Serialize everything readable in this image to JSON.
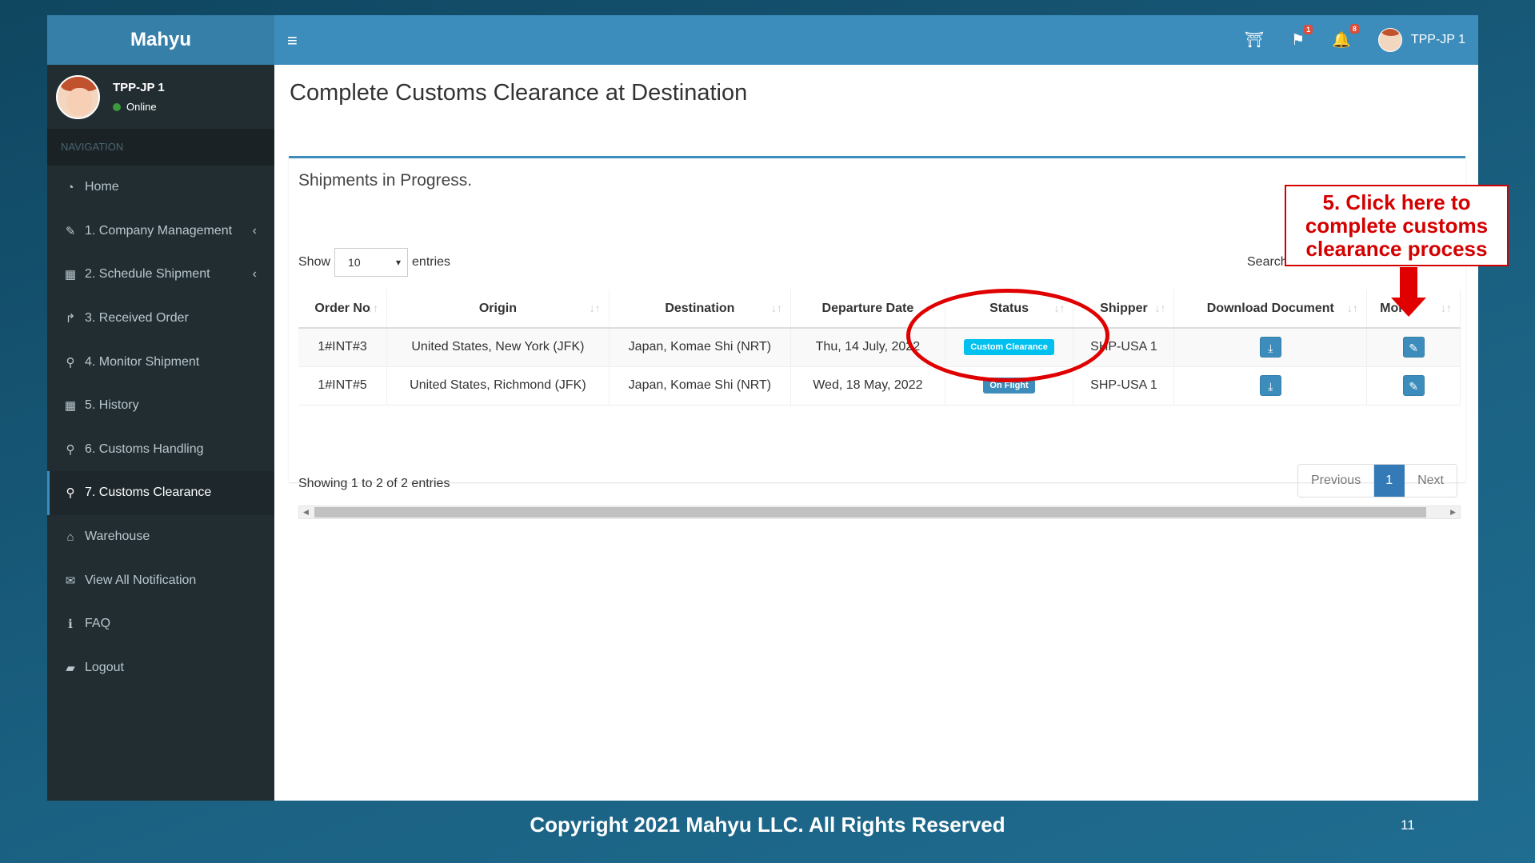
{
  "app": {
    "logo": "Mahyu"
  },
  "user": {
    "name": "TPP-JP 1",
    "status": "Online"
  },
  "nav": {
    "header": "NAVIGATION",
    "items": [
      {
        "label": "Home",
        "icon": "dashboard-icon",
        "glyph": "◔"
      },
      {
        "label": "1. Company Management",
        "icon": "edit-icon",
        "glyph": "✎",
        "arrow": "‹"
      },
      {
        "label": "2. Schedule Shipment",
        "icon": "calendar-icon",
        "glyph": "▦",
        "arrow": "‹"
      },
      {
        "label": "3. Received Order",
        "icon": "share-icon",
        "glyph": "↱"
      },
      {
        "label": "4. Monitor Shipment",
        "icon": "search-icon",
        "glyph": "⚲"
      },
      {
        "label": "5. History",
        "icon": "calendar-icon",
        "glyph": "▦"
      },
      {
        "label": "6. Customs Handling",
        "icon": "search-icon",
        "glyph": "⚲"
      },
      {
        "label": "7. Customs Clearance",
        "icon": "search-icon",
        "glyph": "⚲"
      },
      {
        "label": "Warehouse",
        "icon": "warehouse-icon",
        "glyph": "⌂"
      },
      {
        "label": "View All Notification",
        "icon": "envelope-icon",
        "glyph": "✉"
      },
      {
        "label": "FAQ",
        "icon": "info-icon",
        "glyph": "ℹ"
      },
      {
        "label": "Logout",
        "icon": "book-icon",
        "glyph": "▰"
      }
    ]
  },
  "topbar": {
    "hamburger": "≡",
    "language": "⛩",
    "flag": "⚑",
    "flag_badge": "1",
    "bell": "🔔",
    "bell_badge": "8",
    "user": "TPP-JP 1"
  },
  "page": {
    "title": "Complete Customs Clearance at Destination"
  },
  "box": {
    "title": "Shipments in Progress.",
    "show_label": "Show",
    "show_value": "10",
    "entries_label": "entries",
    "search_label": "Search:"
  },
  "table": {
    "headers": [
      "Order No",
      "Origin",
      "Destination",
      "Departure Date",
      "Status",
      "Shipper",
      "Download Document",
      "More"
    ],
    "rows": [
      {
        "order": "1#INT#3",
        "origin": "United States, New York (JFK)",
        "destination": "Japan, Komae Shi (NRT)",
        "date": "Thu, 14 July, 2022",
        "status": "Custom Clearance",
        "shipper": "SHP-USA 1"
      },
      {
        "order": "1#INT#5",
        "origin": "United States, Richmond (JFK)",
        "destination": "Japan, Komae Shi (NRT)",
        "date": "Wed, 18 May, 2022",
        "status": "On Flight",
        "shipper": "SHP-USA 1"
      }
    ]
  },
  "info": "Showing 1 to 2 of 2 entries",
  "pagination": {
    "previous": "Previous",
    "current": "1",
    "next": "Next"
  },
  "callout": {
    "line1": "5. Click here to",
    "line2": "complete customs",
    "line3": "clearance process"
  },
  "footer": {
    "copyright": "Copyright 2021 Mahyu LLC. All Rights Reserved",
    "page_number": "11"
  },
  "colors": {
    "header_blue": "#3c8dbc",
    "sidebar": "#222d32",
    "annotation_red": "#e00000",
    "label_cyan": "#00c0ef"
  }
}
